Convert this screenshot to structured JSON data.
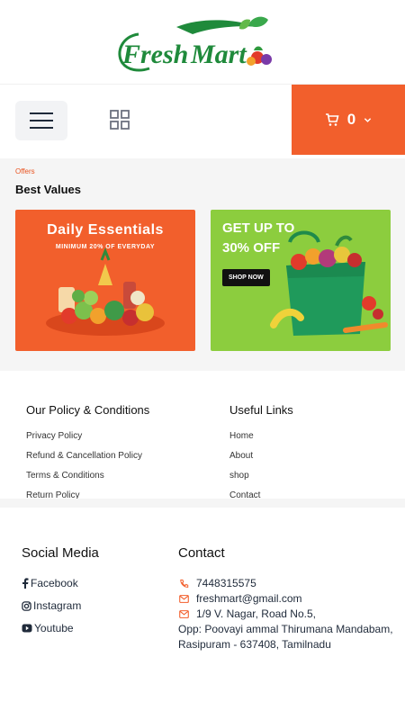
{
  "brand": {
    "name_word1": "Fresh",
    "name_word2": "Mart",
    "green": "#1f8a3b",
    "orange": "#f25f2c"
  },
  "header": {
    "menu_icon": "hamburger-icon",
    "grid_icon": "grid-icon",
    "cart_icon": "cart-icon",
    "cart_count": "0"
  },
  "offers": {
    "kicker": "Offers",
    "title": "Best Values",
    "banner_1": {
      "title": "Daily Essentials",
      "subtitle": "MINIMUM 20% OF EVERYDAY"
    },
    "banner_2": {
      "line1": "GET UP TO",
      "line2": "30% OFF",
      "button": "SHOP NOW"
    }
  },
  "policy": {
    "title": "Our Policy & Conditions",
    "items": [
      "Privacy Policy",
      "Refund & Cancellation Policy",
      "Terms & Conditions",
      "Return Policy"
    ]
  },
  "useful_links": {
    "title": "Useful Links",
    "items": [
      "Home",
      "About",
      "shop",
      "Contact"
    ]
  },
  "social": {
    "title": "Social Media",
    "items": [
      {
        "icon": "facebook-icon",
        "label": "Facebook"
      },
      {
        "icon": "instagram-icon",
        "label": "Instagram"
      },
      {
        "icon": "youtube-icon",
        "label": "Youtube"
      }
    ]
  },
  "contact": {
    "title": "Contact",
    "phone": "7448315575",
    "email": "freshmart@gmail.com",
    "address_line1": "1/9 V. Nagar, Road No.5,",
    "address_line2": "Opp: Poovayi ammal Thirumana Mandabam,",
    "address_line3": "Rasipuram - 637408, Tamilnadu"
  }
}
